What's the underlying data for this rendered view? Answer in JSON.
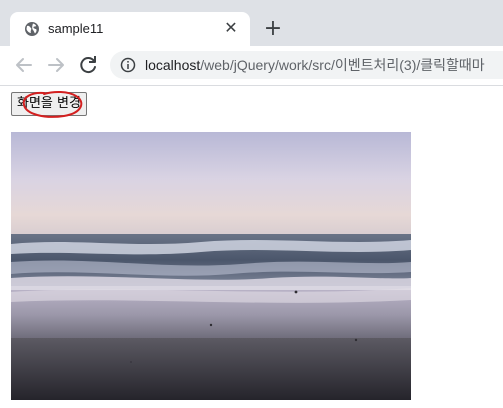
{
  "browser": {
    "tab": {
      "title": "sample11",
      "favicon": "globe-icon",
      "close_label": "✕"
    },
    "new_tab_label": "+",
    "toolbar": {
      "back_icon": "arrow-left-icon",
      "forward_icon": "arrow-right-icon",
      "reload_icon": "reload-icon",
      "info_icon": "info-icon",
      "url_host": "localhost",
      "url_path": "/web/jQuery/work/src/이벤트처리(3)/클릭할때마"
    }
  },
  "page": {
    "button_label": "화면을 변경",
    "annotation_color": "#d32020",
    "image": "beach-seascape-photo"
  }
}
